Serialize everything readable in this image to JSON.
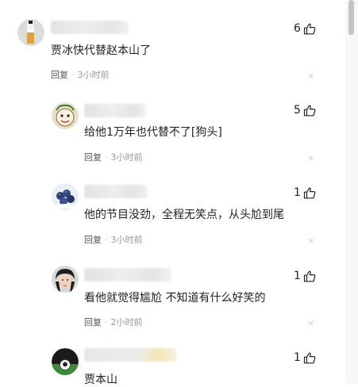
{
  "comments": [
    {
      "text": "贾冰快代替赵本山了",
      "reply_label": "回复",
      "time": "3小时前",
      "likes": "6",
      "avatar_icon": "avatar-bottle-icon"
    },
    {
      "text": "给他1万年也代替不了[狗头]",
      "reply_label": "回复",
      "time": "3小时前",
      "likes": "5",
      "avatar_icon": "avatar-cartoon-icon"
    },
    {
      "text": "他的节目没劲，全程无笑点，从头尬到尾",
      "reply_label": "回复",
      "time": "3小时前",
      "likes": "1",
      "avatar_icon": "avatar-blueberries-icon"
    },
    {
      "text": "看他就觉得尴尬 不知道有什么好笑的",
      "reply_label": "回复",
      "time": "2小时前",
      "likes": "1",
      "avatar_icon": "avatar-person-icon"
    },
    {
      "text": "贾本山",
      "likes": "1",
      "avatar_icon": "avatar-football-icon"
    }
  ],
  "close_glyph": "×",
  "colors": {
    "text": "#222222",
    "meta": "#999999",
    "scrollbar": "#c4c4c4"
  }
}
